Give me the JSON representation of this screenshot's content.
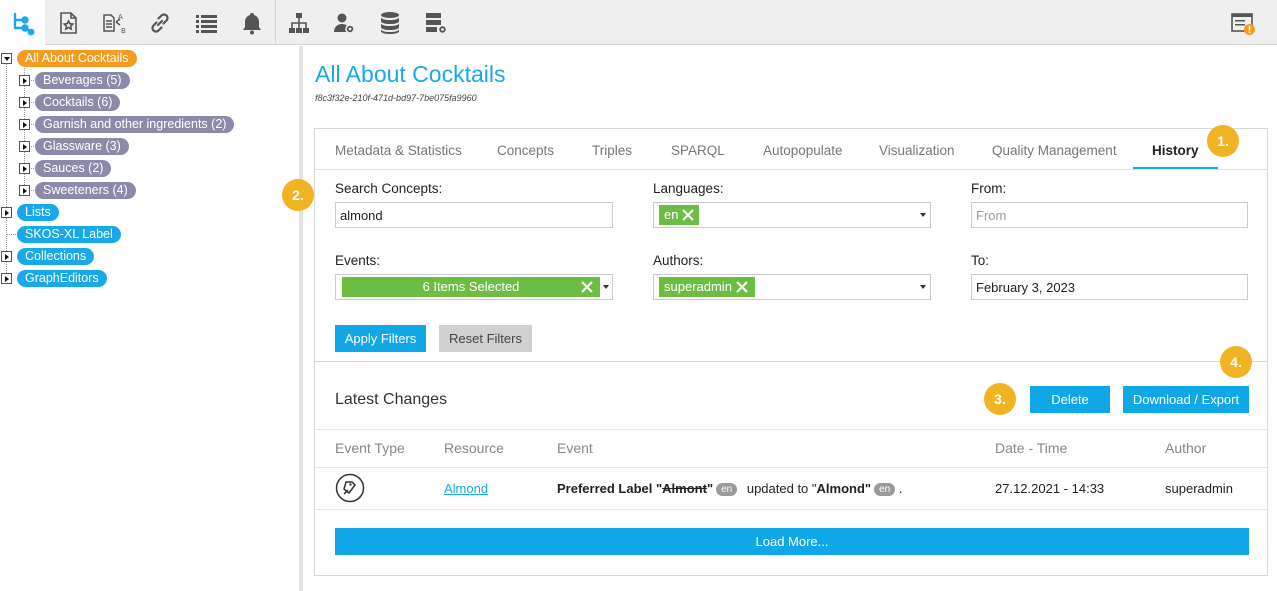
{
  "toolbar": {
    "items": [
      {
        "icon": "taxonomy-tree-icon",
        "active": true
      },
      {
        "icon": "favorites-document-icon"
      },
      {
        "icon": "label-translation-icon"
      },
      {
        "icon": "link-icon"
      },
      {
        "icon": "list-icon"
      },
      {
        "icon": "notifications-bell-icon"
      },
      {
        "icon": "hierarchy-icon"
      },
      {
        "icon": "user-settings-icon"
      },
      {
        "icon": "database-icon"
      },
      {
        "icon": "server-settings-icon"
      }
    ],
    "right_icon": "alerts-warning-icon"
  },
  "tree": {
    "root": "All About Cocktails",
    "children": [
      "Beverages (5)",
      "Cocktails (6)",
      "Garnish and other ingredients (2)",
      "Glassware (3)",
      "Sauces (2)",
      "Sweeteners (4)"
    ],
    "other": [
      "Lists",
      "SKOS-XL Label",
      "Collections",
      "GraphEditors"
    ]
  },
  "page": {
    "title": "All About Cocktails",
    "uuid": "f8c3f32e-210f-471d-bd97-7be075fa9960"
  },
  "tabs": [
    "Metadata & Statistics",
    "Concepts",
    "Triples",
    "SPARQL",
    "Autopopulate",
    "Visualization",
    "Quality Management",
    "History"
  ],
  "active_tab": "History",
  "filters": {
    "search_label": "Search Concepts:",
    "search_value": "almond",
    "languages_label": "Languages:",
    "languages_chip": "en",
    "from_label": "From:",
    "from_placeholder": "From",
    "events_label": "Events:",
    "events_chip": "6 Items Selected",
    "authors_label": "Authors:",
    "authors_chip": "superadmin",
    "to_label": "To:",
    "to_value": "February 3, 2023",
    "apply": "Apply Filters",
    "reset": "Reset Filters"
  },
  "changes": {
    "title": "Latest Changes",
    "delete": "Delete",
    "export": "Download / Export",
    "columns": [
      "Event Type",
      "Resource",
      "Event",
      "Date - Time",
      "Author"
    ],
    "row": {
      "event_icon": "label-edit-icon",
      "resource": "Almond",
      "event_prefix": "Preferred Label \"",
      "old_value": "Almont",
      "old_close": "\"",
      "old_lang": "en",
      "event_mid": " updated to \"",
      "new_value": "Almond",
      "new_close": "\"",
      "new_lang": "en",
      "event_end": " .",
      "datetime": "27.12.2021 - 14:33",
      "author": "superadmin"
    },
    "load_more": "Load More..."
  },
  "badges": [
    "1.",
    "2.",
    "3.",
    "4."
  ],
  "colors": {
    "accent": "#19a9e8",
    "badge": "#f0b323",
    "chip": "#6dbd45",
    "root_node": "#f39c1f",
    "concept_node": "#8b8aa9"
  }
}
